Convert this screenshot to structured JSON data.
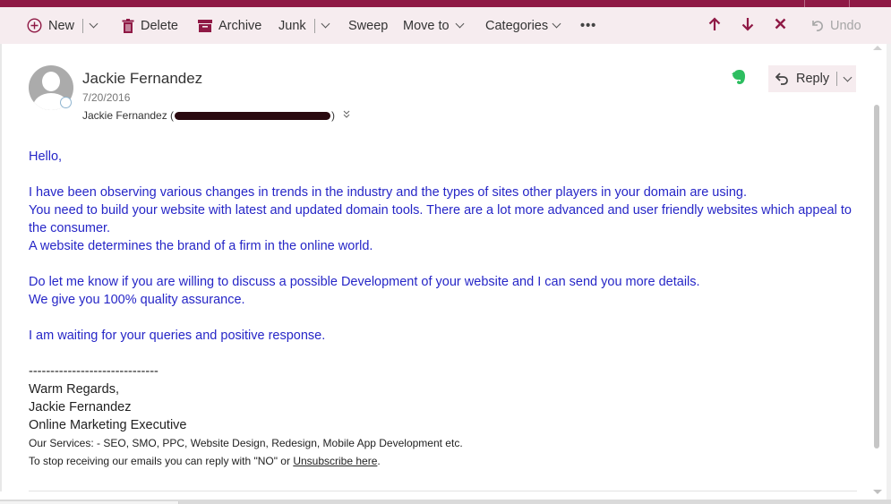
{
  "colors": {
    "brand": "#8f1945",
    "toolbar_bg": "#f6ecef",
    "body_text": "#2626c7",
    "signature_text": "#222222",
    "evernote_green": "#2dbe60"
  },
  "toolbar": {
    "new_label": "New",
    "delete_label": "Delete",
    "archive_label": "Archive",
    "junk_label": "Junk",
    "sweep_label": "Sweep",
    "move_to_label": "Move to",
    "categories_label": "Categories",
    "more_label": "•••",
    "undo_label": "Undo",
    "icons": {
      "new": "plus-circle-icon",
      "delete": "trash-icon",
      "archive": "archive-box-icon",
      "up": "arrow-up-icon",
      "down": "arrow-down-icon",
      "close": "close-icon",
      "undo": "undo-icon"
    }
  },
  "message": {
    "sender_name": "Jackie Fernandez",
    "date": "7/20/2016",
    "from_prefix": "Jackie Fernandez (",
    "from_suffix": ")",
    "reply_label": "Reply",
    "body": {
      "greeting": "Hello,",
      "p1_l1": "I have been observing various changes in trends in the industry and the types of sites other players in your domain are using.",
      "p1_l2": "You need to build your website with latest and updated domain tools. There are a lot more advanced and user friendly websites which appeal to the consumer.",
      "p1_l3": "A website determines the brand of a firm in the online world.",
      "p2_l1": "Do let me know if you are willing to discuss a possible Development of your website and I can send you more details.",
      "p2_l2": "We give you 100% quality assurance.",
      "p3": "I am waiting for your queries and positive response."
    },
    "signature": {
      "separator": "------------------------------",
      "closing": "Warm Regards,",
      "name": "Jackie Fernandez",
      "title": "Online Marketing Executive",
      "services": "Our Services: - SEO, SMO, PPC, Website Design, Redesign, Mobile App Development etc.",
      "unsubscribe_prefix": "To stop receiving our emails you can reply with \"NO\" or ",
      "unsubscribe_link": "Unsubscribe here",
      "unsubscribe_suffix": "."
    }
  }
}
